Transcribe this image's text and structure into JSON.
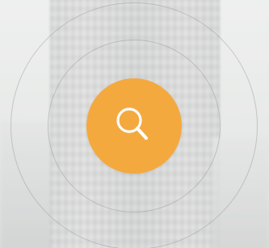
{
  "background": {
    "scene": "blurred-skyscraper-photo"
  },
  "search_button": {
    "icon": "search-icon",
    "color": "#f4a93e",
    "icon_color": "#ffffff"
  }
}
